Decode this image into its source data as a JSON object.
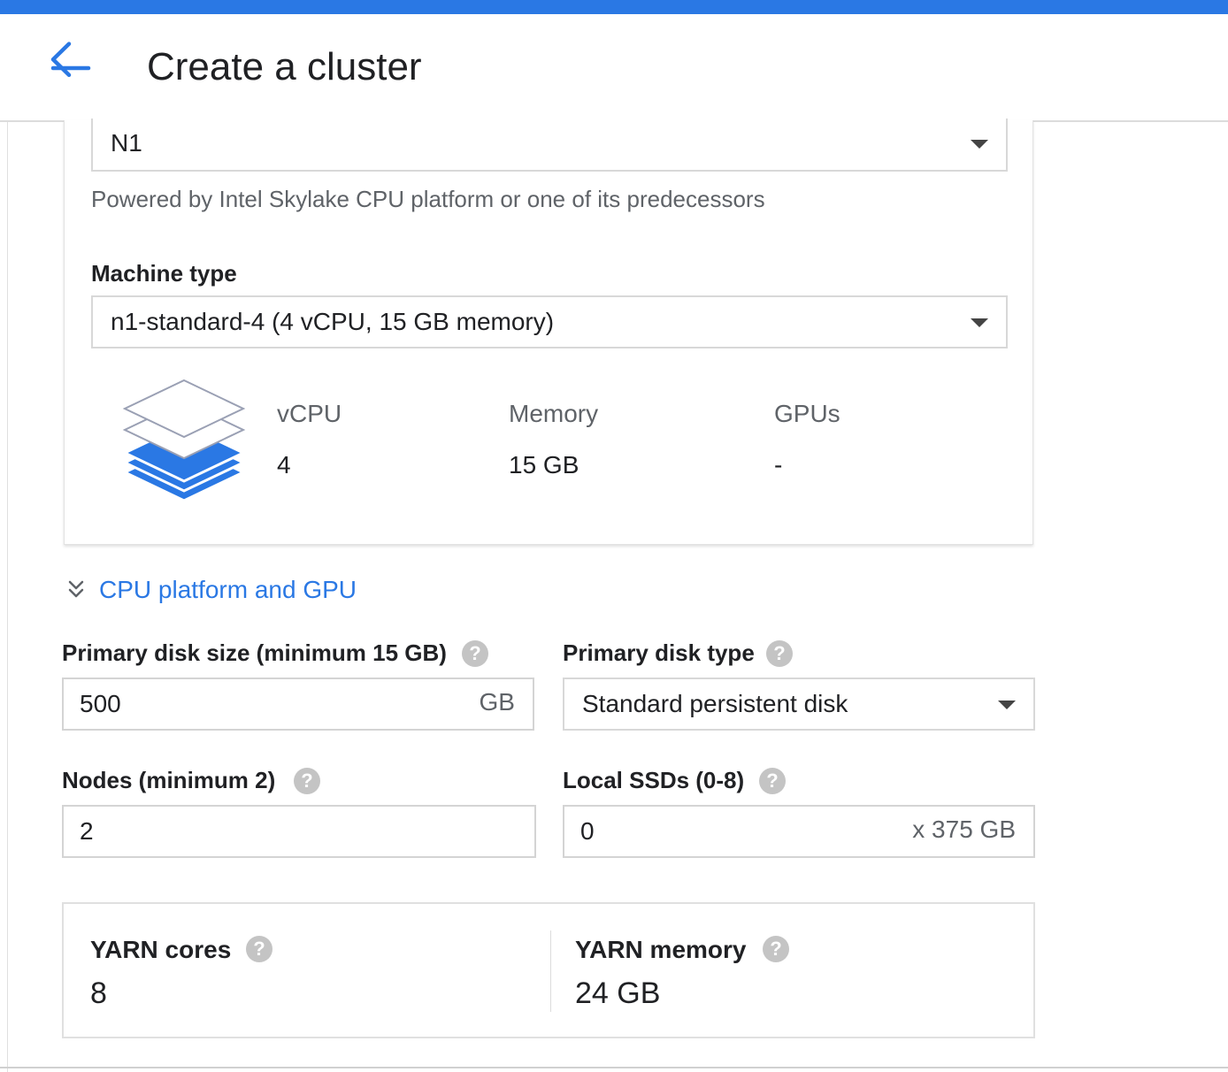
{
  "header": {
    "title": "Create a cluster"
  },
  "machine_config": {
    "series": {
      "value": "N1"
    },
    "series_hint": "Powered by Intel Skylake CPU platform or one of its predecessors",
    "machine_type": {
      "label": "Machine type",
      "value": "n1-standard-4 (4 vCPU, 15 GB memory)"
    },
    "specs": {
      "vcpu_label": "vCPU",
      "vcpu_value": "4",
      "memory_label": "Memory",
      "memory_value": "15 GB",
      "gpus_label": "GPUs",
      "gpus_value": "-"
    }
  },
  "cpu_platform_link": "CPU platform and GPU",
  "disk": {
    "size_label": "Primary disk size (minimum 15 GB)",
    "size_value": "500",
    "size_unit": "GB",
    "type_label": "Primary disk type",
    "type_value": "Standard persistent disk"
  },
  "nodes": {
    "label": "Nodes (minimum 2)",
    "value": "2"
  },
  "local_ssds": {
    "label": "Local SSDs (0-8)",
    "value": "0",
    "suffix": "x 375 GB"
  },
  "yarn": {
    "cores_label": "YARN cores",
    "cores_value": "8",
    "memory_label": "YARN memory",
    "memory_value": "24 GB"
  },
  "help_glyph": "?",
  "colors": {
    "accent": "#2a78e4",
    "help_icon": "#c4c4c4",
    "border": "#d8d8d8"
  }
}
